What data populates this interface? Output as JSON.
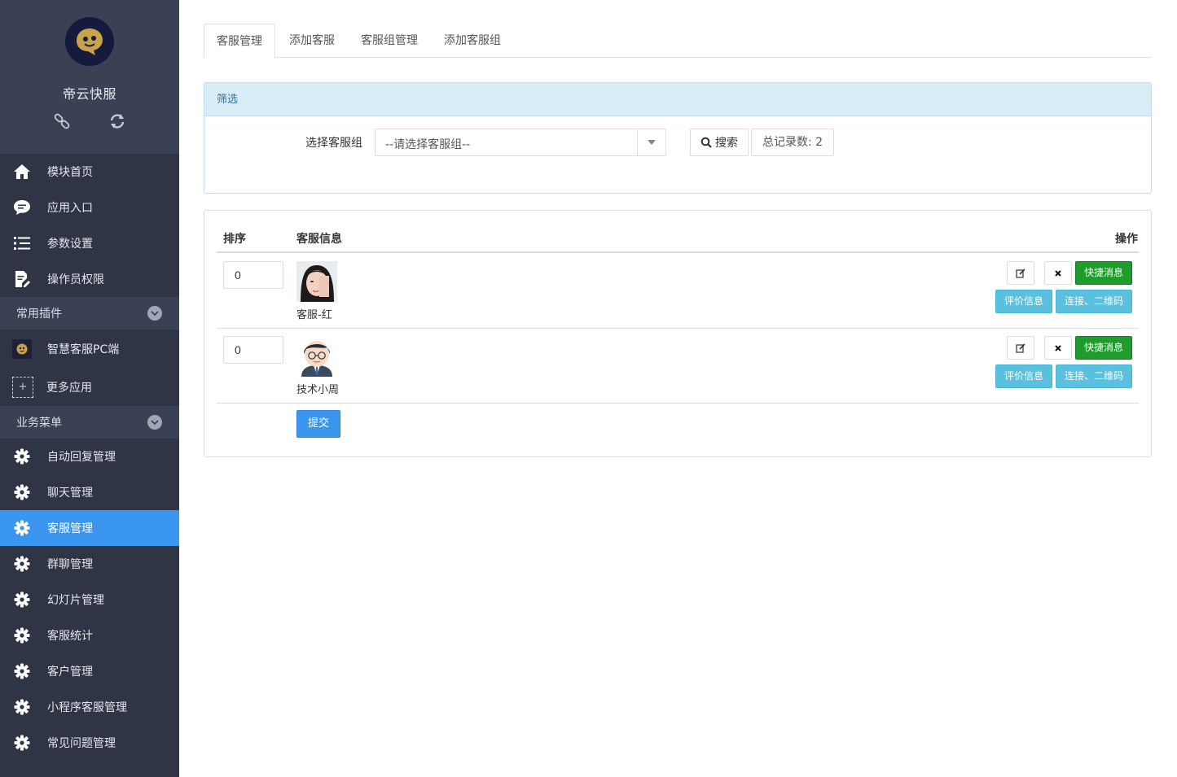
{
  "sidebar": {
    "brand": "帝云快服",
    "main_items": [
      {
        "label": "模块首页"
      },
      {
        "label": "应用入口"
      },
      {
        "label": "参数设置"
      },
      {
        "label": "操作员权限"
      }
    ],
    "sections": {
      "plugins": "常用插件",
      "business": "业务菜单"
    },
    "plugins": [
      {
        "label": "智慧客服PC端"
      },
      {
        "label": "更多应用",
        "icon_text": "+"
      }
    ],
    "business_items": [
      {
        "label": "自动回复管理"
      },
      {
        "label": "聊天管理"
      },
      {
        "label": "客服管理"
      },
      {
        "label": "群聊管理"
      },
      {
        "label": "幻灯片管理"
      },
      {
        "label": "客服统计"
      },
      {
        "label": "客户管理"
      },
      {
        "label": "小程序客服管理"
      },
      {
        "label": "常见问题管理"
      }
    ],
    "active_color": "#3a96ef",
    "background_color": "#2f3545"
  },
  "tabs": [
    "客服管理",
    "添加客服",
    "客服组管理",
    "添加客服组"
  ],
  "filter": {
    "heading": "筛选",
    "label": "选择客服组",
    "select_value": "--请选择客服组--",
    "search_label": "搜索",
    "total_label": "总记录数: 2"
  },
  "table": {
    "headers": {
      "sort": "排序",
      "info": "客服信息",
      "ops": "操作"
    },
    "rows": [
      {
        "sort": "0",
        "name": "客服-红",
        "avatar": "female-photo"
      },
      {
        "sort": "0",
        "name": "技术小周",
        "avatar": "cartoon-male"
      }
    ],
    "actions": {
      "quick_msg": "快捷消息",
      "rating": "评价信息",
      "link_qr": "连接、二维码"
    },
    "submit": "提交"
  }
}
